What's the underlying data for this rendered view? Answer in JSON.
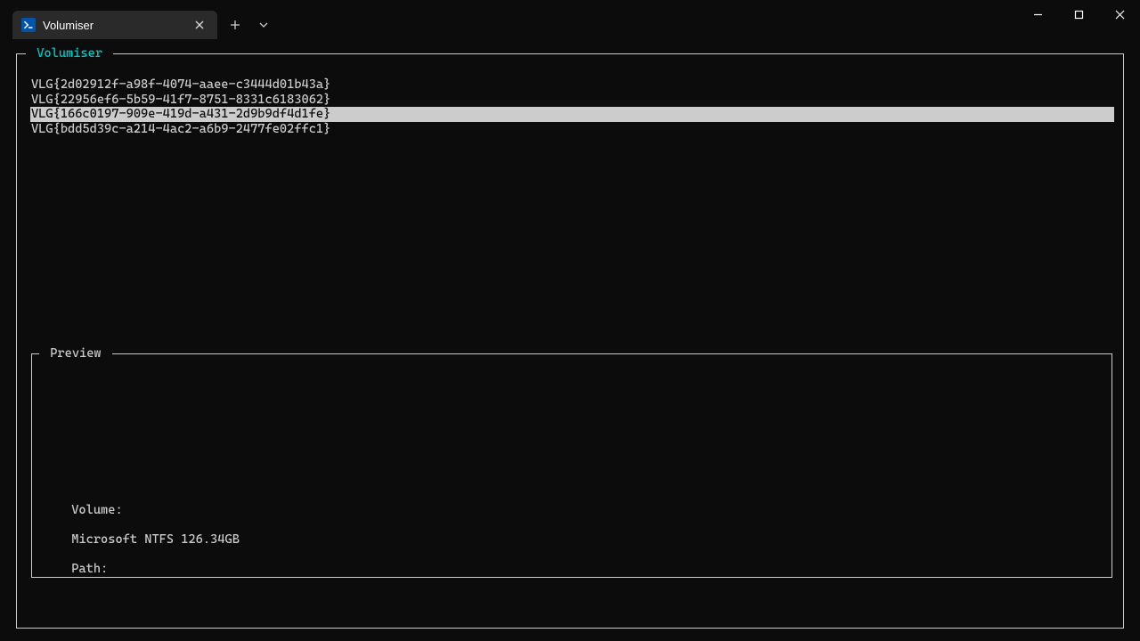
{
  "window": {
    "tab_title": "Volumiser"
  },
  "tui": {
    "main_label": " Volumiser ",
    "preview_label": " Preview ",
    "items": [
      {
        "text": "VLG{2d02912f-a98f-4074-aaee-c3444d01b43a}",
        "selected": false
      },
      {
        "text": "VLG{22956ef6-5b59-41f7-8751-8331c6183062}",
        "selected": false
      },
      {
        "text": "VLG{166c0197-909e-419d-a431-2d9b9df4d1fe}",
        "selected": true
      },
      {
        "text": "VLG{bdd5d39c-a214-4ac2-a6b9-2477fe02ffc1}",
        "selected": false
      }
    ],
    "status": {
      "volume_label": "Volume:",
      "volume_value": "Microsoft NTFS 126.34GB",
      "path_label": "Path:",
      "path_value": ""
    }
  }
}
